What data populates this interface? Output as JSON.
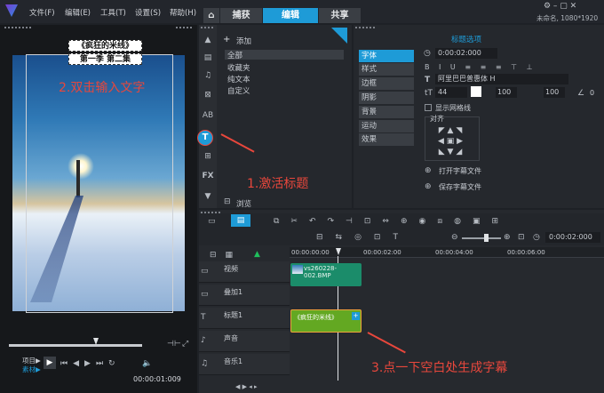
{
  "menu": {
    "items": [
      "文件(F)",
      "编辑(E)",
      "工具(T)",
      "设置(S)",
      "帮助(H)"
    ],
    "tabs": [
      "捕获",
      "编辑",
      "共享"
    ],
    "project": "未命名, 1080*1920"
  },
  "colors": {
    "accent": "#1e9bd7",
    "annotation": "#e8473c",
    "clip_video": "#1b8c6a",
    "clip_title": "#63a822"
  },
  "preview": {
    "title_line1": "《疯狂的米线》",
    "title_line2": "第一季  第二集",
    "annotation": "2.双击输入文字",
    "mode_project": "项目▶",
    "mode_clip": "素材▶",
    "timecode": "00:00:01:009"
  },
  "library": {
    "add_label": "添加",
    "folders": [
      "全部",
      "收藏夹",
      "纯文本",
      "自定义"
    ],
    "annotation": "1.激活标题",
    "browse_label": "浏览"
  },
  "title_options": {
    "header": "标题选项",
    "tabs": [
      "字体",
      "样式",
      "边框",
      "阴影",
      "背景",
      "运动",
      "效果"
    ],
    "duration": "0:00:02:000",
    "font_name": "阿里巴巴普惠体 H",
    "font_size": "44",
    "line_spacing": "100",
    "tracking": "100",
    "angle": "0",
    "show_grid": "显示网格线",
    "align_label": "对齐",
    "open_subtitle": "打开字幕文件",
    "save_subtitle": "保存字幕文件"
  },
  "timeline": {
    "timecode": "0:00:02:000",
    "ruler": [
      "00:00:00:00",
      "00:00:02:00",
      "00:00:04:00",
      "00:00:06:00"
    ],
    "tracks": [
      "视频",
      "叠加1",
      "标题1",
      "声音",
      "音乐1"
    ],
    "video_clip": "vs260228-002.BMP",
    "title_clip": "《疯狂的米线》",
    "annotation": "3.点一下空白处生成字幕"
  }
}
